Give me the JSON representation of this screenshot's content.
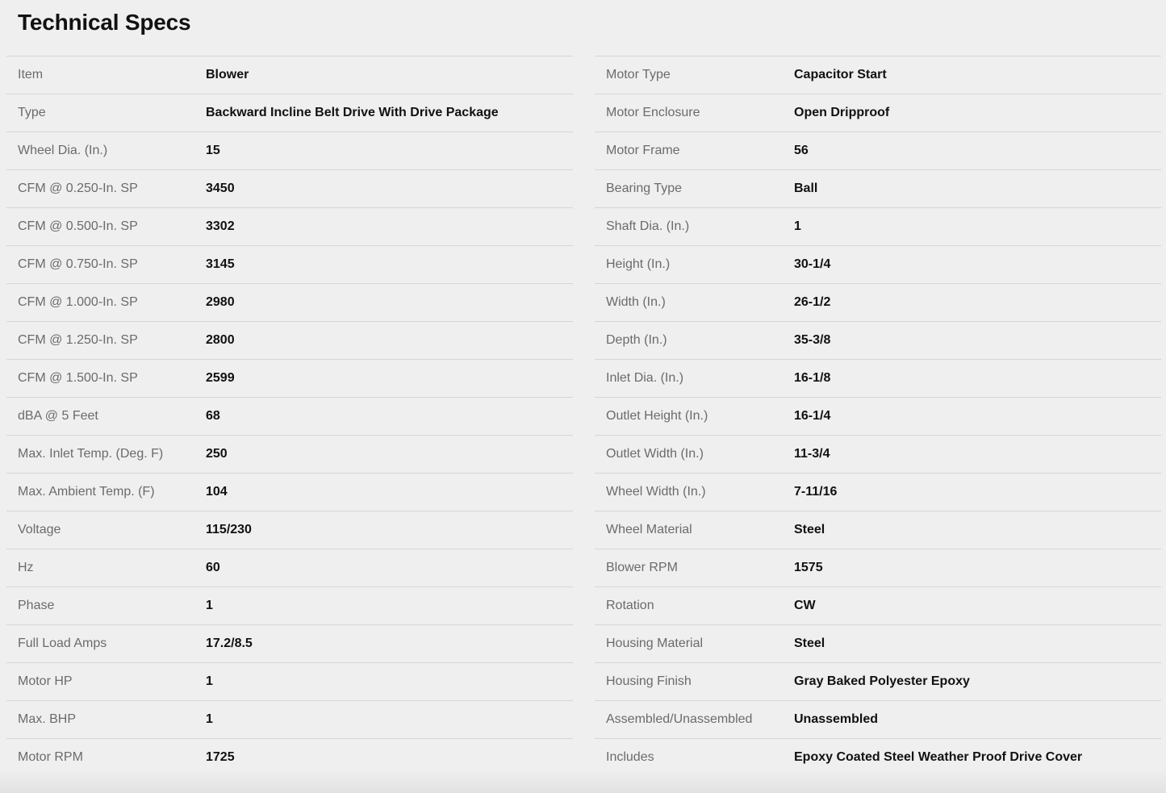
{
  "title": "Technical Specs",
  "left_specs": [
    {
      "label": "Item",
      "value": "Blower"
    },
    {
      "label": "Type",
      "value": "Backward Incline Belt Drive With Drive Package"
    },
    {
      "label": "Wheel Dia. (In.)",
      "value": "15"
    },
    {
      "label": "CFM @ 0.250-In. SP",
      "value": "3450"
    },
    {
      "label": "CFM @ 0.500-In. SP",
      "value": "3302"
    },
    {
      "label": "CFM @ 0.750-In. SP",
      "value": "3145"
    },
    {
      "label": "CFM @ 1.000-In. SP",
      "value": "2980"
    },
    {
      "label": "CFM @ 1.250-In. SP",
      "value": "2800"
    },
    {
      "label": "CFM @ 1.500-In. SP",
      "value": "2599"
    },
    {
      "label": "dBA @ 5 Feet",
      "value": "68"
    },
    {
      "label": "Max. Inlet Temp. (Deg. F)",
      "value": "250"
    },
    {
      "label": "Max. Ambient Temp. (F)",
      "value": "104"
    },
    {
      "label": "Voltage",
      "value": "115/230"
    },
    {
      "label": "Hz",
      "value": "60"
    },
    {
      "label": "Phase",
      "value": "1"
    },
    {
      "label": "Full Load Amps",
      "value": "17.2/8.5"
    },
    {
      "label": "Motor HP",
      "value": "1"
    },
    {
      "label": "Max. BHP",
      "value": "1"
    },
    {
      "label": "Motor RPM",
      "value": "1725"
    }
  ],
  "right_specs": [
    {
      "label": "Motor Type",
      "value": "Capacitor Start"
    },
    {
      "label": "Motor Enclosure",
      "value": "Open Dripproof"
    },
    {
      "label": "Motor Frame",
      "value": "56"
    },
    {
      "label": "Bearing Type",
      "value": "Ball"
    },
    {
      "label": "Shaft Dia. (In.)",
      "value": "1"
    },
    {
      "label": "Height (In.)",
      "value": "30-1/4"
    },
    {
      "label": "Width (In.)",
      "value": "26-1/2"
    },
    {
      "label": "Depth (In.)",
      "value": "35-3/8"
    },
    {
      "label": "Inlet Dia. (In.)",
      "value": "16-1/8"
    },
    {
      "label": "Outlet Height (In.)",
      "value": "16-1/4"
    },
    {
      "label": "Outlet Width (In.)",
      "value": "11-3/4"
    },
    {
      "label": "Wheel Width (In.)",
      "value": "7-11/16"
    },
    {
      "label": "Wheel Material",
      "value": "Steel"
    },
    {
      "label": "Blower RPM",
      "value": "1575"
    },
    {
      "label": "Rotation",
      "value": "CW"
    },
    {
      "label": "Housing Material",
      "value": "Steel"
    },
    {
      "label": "Housing Finish",
      "value": "Gray Baked Polyester Epoxy"
    },
    {
      "label": "Assembled/Unassembled",
      "value": "Unassembled"
    },
    {
      "label": "Includes",
      "value": "Epoxy Coated Steel Weather Proof Drive Cover"
    }
  ]
}
